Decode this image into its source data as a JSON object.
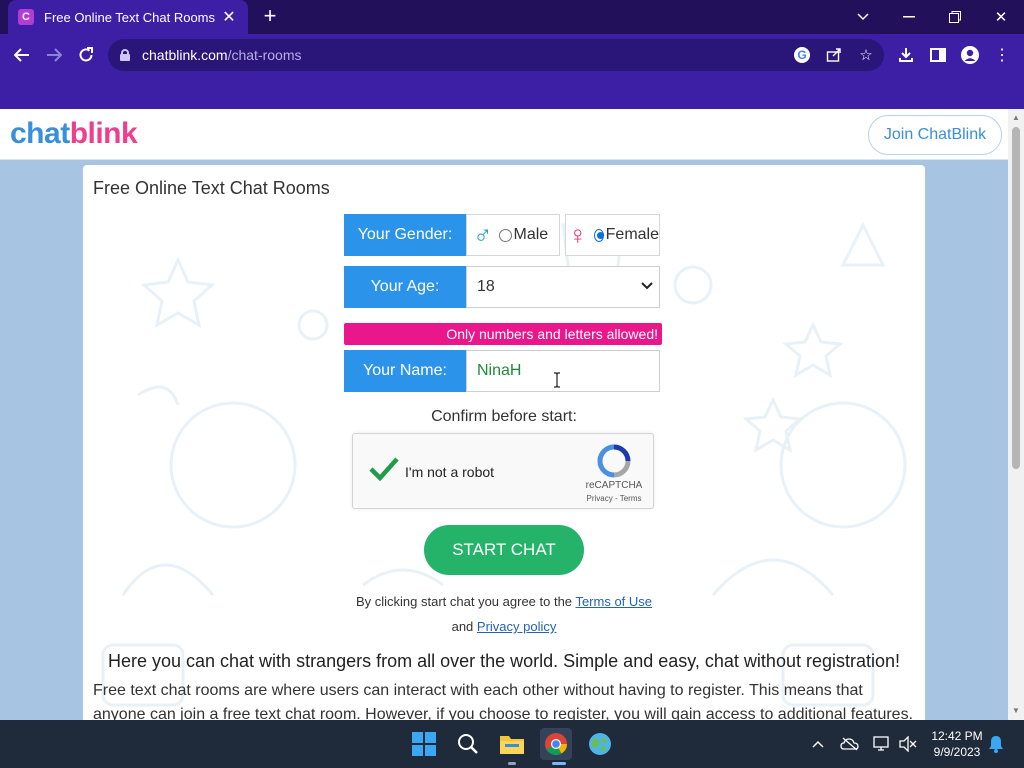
{
  "browser": {
    "tab_title": "Free Online Text Chat Rooms",
    "tab_favicon_letter": "C",
    "url_host": "chatblink.com",
    "url_path": "/chat-rooms"
  },
  "site": {
    "logo_part1": "chat",
    "logo_part2": "blink",
    "join_button": "Join ChatBlink"
  },
  "form": {
    "title": "Free Online Text Chat Rooms",
    "gender_label": "Your Gender:",
    "gender_options": [
      "Male",
      "Female"
    ],
    "gender_selected": "Female",
    "age_label": "Your Age:",
    "age_value": "18",
    "name_warning": "Only numbers and letters allowed!",
    "name_label": "Your Name:",
    "name_value": "NinaH",
    "confirm_label": "Confirm before start:",
    "recaptcha_text": "I'm not a robot",
    "recaptcha_brand": "reCAPTCHA",
    "recaptcha_links": "Privacy - Terms",
    "start_button": "START CHAT",
    "agree_prefix": "By clicking start chat you agree to the",
    "terms_link": "Terms of Use",
    "agree_and": "and",
    "privacy_link": "Privacy policy"
  },
  "content": {
    "headline": "Here you can chat with strangers from all over the world. Simple and easy, chat without registration!",
    "paragraph": "Free text chat rooms are where users can interact with each other without having to register. This means that anyone can join a free text chat room. However, if you choose to register, you will gain access to additional features."
  },
  "taskbar": {
    "time": "12:42 PM",
    "date": "9/9/2023"
  },
  "colors": {
    "browser_frame": "#22105a",
    "browser_toolbar": "#3d1fa6",
    "label_blue": "#2b94ea",
    "warning_pink": "#e9168c",
    "start_green": "#25b36a",
    "page_bg": "#a8c4e3"
  }
}
